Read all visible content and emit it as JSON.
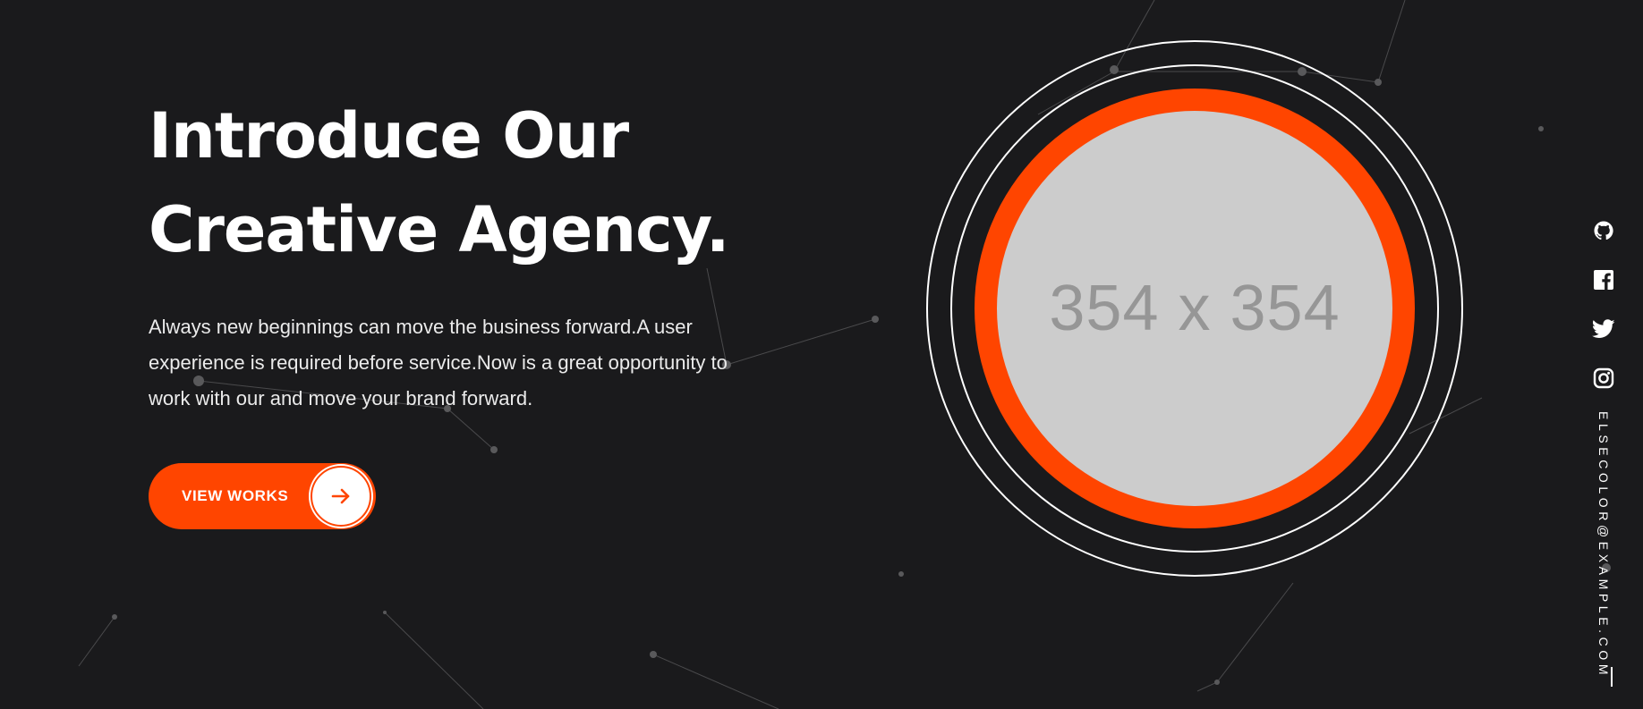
{
  "hero": {
    "heading_line_1": "Introduce Our",
    "heading_line_2": "Creative Agency.",
    "description": "Always new beginnings can move the business forward.A user experience is required before service.Now is a great opportunity to work with our and move your brand forward.",
    "cta_label": "VIEW WORKS",
    "cta_icon": "arrow-right-icon"
  },
  "media": {
    "placeholder_label": "354 x 354"
  },
  "social": {
    "icons": [
      "github-icon",
      "facebook-icon",
      "twitter-icon",
      "instagram-icon"
    ],
    "email": "ELSECOLOR@EXAMPLE.COM"
  },
  "colors": {
    "background": "#1a1a1c",
    "accent": "#ff4500",
    "text": "#ffffff",
    "placeholder_bg": "#cccccc",
    "placeholder_text": "#969696"
  }
}
